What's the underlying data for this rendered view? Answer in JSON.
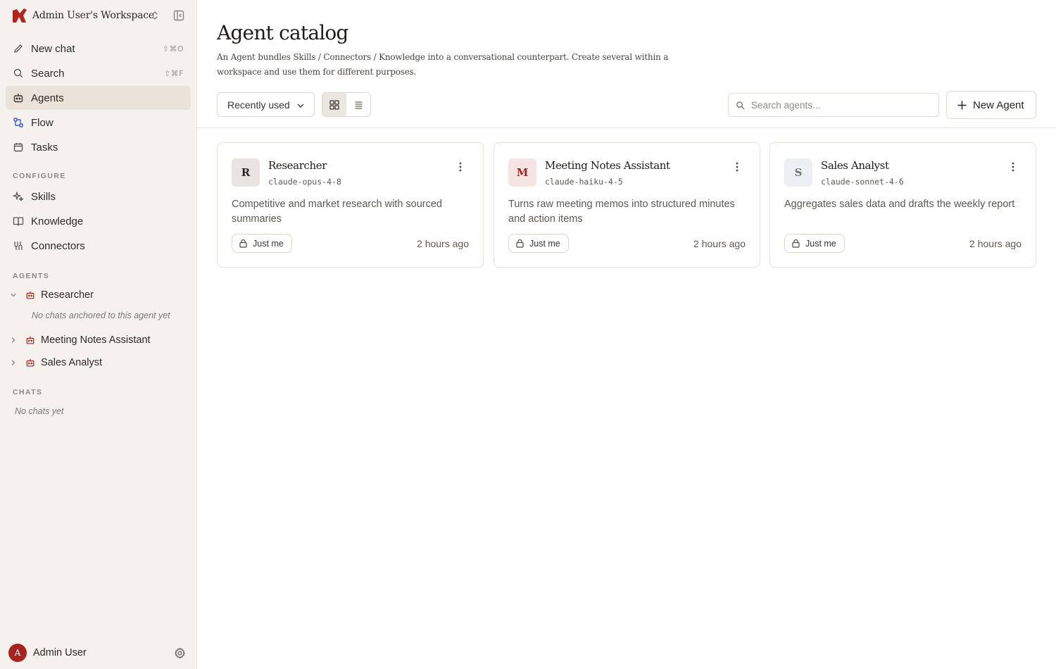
{
  "workspace": {
    "name": "Admin User's Workspace"
  },
  "nav": [
    {
      "id": "new-chat",
      "label": "New chat",
      "shortcut": "⇧⌘O",
      "icon": "pencil-icon"
    },
    {
      "id": "search",
      "label": "Search",
      "shortcut": "⇧⌘F",
      "icon": "search-icon"
    },
    {
      "id": "agents",
      "label": "Agents",
      "icon": "robot-icon",
      "active": true
    },
    {
      "id": "flow",
      "label": "Flow",
      "icon": "flow-icon"
    },
    {
      "id": "tasks",
      "label": "Tasks",
      "icon": "calendar-icon"
    }
  ],
  "configure": {
    "label": "CONFIGURE",
    "items": [
      {
        "label": "Skills",
        "icon": "sparkle-icon"
      },
      {
        "label": "Knowledge",
        "icon": "book-icon"
      },
      {
        "label": "Connectors",
        "icon": "connector-icon"
      }
    ]
  },
  "agents_section": {
    "label": "AGENTS",
    "items": [
      {
        "label": "Researcher",
        "expanded": true,
        "empty_note": "No chats anchored to this agent yet"
      },
      {
        "label": "Meeting Notes Assistant",
        "expanded": false
      },
      {
        "label": "Sales Analyst",
        "expanded": false
      }
    ]
  },
  "chats_section": {
    "label": "CHATS",
    "empty_note": "No chats yet"
  },
  "user": {
    "initial": "A",
    "name": "Admin User"
  },
  "page": {
    "title": "Agent catalog",
    "description": "An Agent bundles Skills / Connectors / Knowledge into a conversational counterpart. Create several within a workspace and use them for different purposes."
  },
  "toolbar": {
    "sort_label": "Recently used",
    "view_mode": "grid",
    "search_placeholder": "Search agents...",
    "new_agent_label": "New Agent"
  },
  "cards": [
    {
      "initial": "R",
      "name": "Researcher",
      "model": "claude-opus-4-8",
      "description": "Competitive and market research with sourced summaries",
      "visibility": "Just me",
      "updated": "2 hours ago",
      "badge_bg": "#e8e5e1",
      "badge_fg": "#2a2622"
    },
    {
      "initial": "M",
      "name": "Meeting Notes Assistant",
      "model": "claude-haiku-4-5",
      "description": "Turns raw meeting memos into structured minutes and action items",
      "visibility": "Just me",
      "updated": "2 hours ago",
      "badge_bg": "#f6e4e2",
      "badge_fg": "#a8231f"
    },
    {
      "initial": "S",
      "name": "Sales Analyst",
      "model": "claude-sonnet-4-6",
      "description": "Aggregates sales data and drafts the weekly report",
      "visibility": "Just me",
      "updated": "2 hours ago",
      "badge_bg": "#edf0f3",
      "badge_fg": "#6b7580"
    }
  ],
  "colors": {
    "accent": "#a8231f",
    "sidebar_bg": "#f5f2ed",
    "active_bg": "#ebe3d9",
    "flow_icon": "#3b5bd9"
  }
}
